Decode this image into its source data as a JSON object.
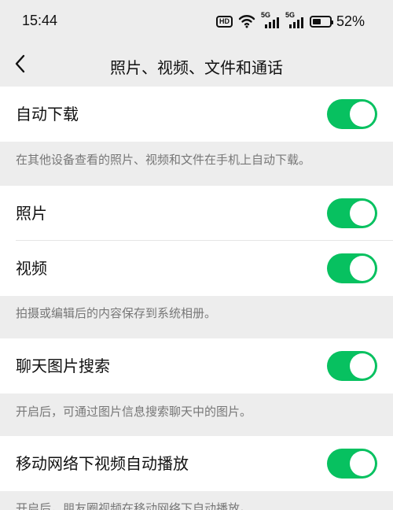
{
  "status_bar": {
    "time": "15:44",
    "hd_label": "HD",
    "network_1": "5G",
    "network_2": "5G",
    "battery_percent": "52%",
    "battery_level": 52
  },
  "header": {
    "title": "照片、视频、文件和通话",
    "back_icon": "chevron-left-icon"
  },
  "theme": {
    "toggle_on": "#07c160",
    "background": "#ededed",
    "card": "#ffffff",
    "secondary_text": "#777777"
  },
  "settings": {
    "auto_download": {
      "label": "自动下载",
      "enabled": true,
      "description": "在其他设备查看的照片、视频和文件在手机上自动下载。"
    },
    "photos": {
      "label": "照片",
      "enabled": true
    },
    "videos": {
      "label": "视频",
      "enabled": true
    },
    "save_description": "拍摄或编辑后的内容保存到系统相册。",
    "image_search": {
      "label": "聊天图片搜索",
      "enabled": true,
      "description": "开启后，可通过图片信息搜索聊天中的图片。"
    },
    "mobile_autoplay": {
      "label": "移动网络下视频自动播放",
      "enabled": true,
      "description": "开启后，朋友圈视频在移动网络下自动播放。"
    }
  }
}
